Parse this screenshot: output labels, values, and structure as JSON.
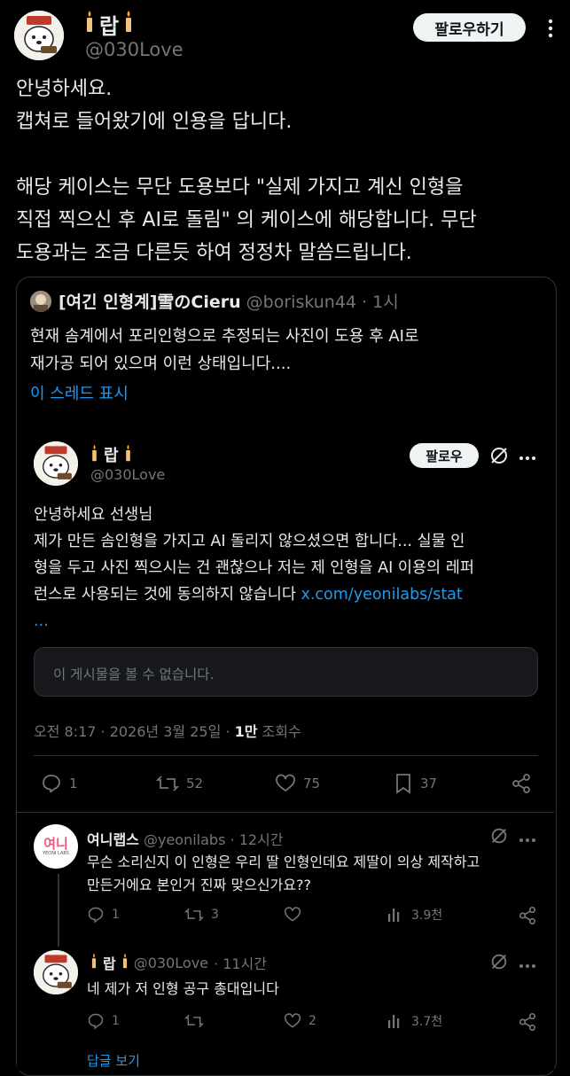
{
  "author": {
    "display_name": "랍",
    "handle": "@030Love",
    "follow_label": "팔로우하기"
  },
  "main_post": {
    "lines": [
      "안녕하세요.",
      "캡쳐로 들어왔기에 인용을 답니다.",
      "",
      "해당 케이스는 무단 도용보다 \"실제 가지고 계신 인형을",
      "직접 찍으신 후 AI로 돌림\" 의 케이스에 해당합니다. 무단",
      "도용과는 조금 다른듯 하여 정정차 말씀드립니다."
    ]
  },
  "quoted": {
    "display_name": "[여긴 인형계]雪のCieru",
    "handle": "@boriskun44",
    "time": "· 1시",
    "lines": [
      "현재 솜계에서 포리인형으로 추정되는 사진이 도용 후  AI로",
      "재가공 되어 있으며 이런 상태입니다...."
    ],
    "show_thread": "이 스레드 표시"
  },
  "inner_post": {
    "display_name": "랍",
    "handle": "@030Love",
    "follow_label": "팔로우",
    "lines": [
      "안녕하세요 선생님",
      "제가 만든 솜인형을 가지고 AI 돌리지 않으셨으면 합니다... 실물 인",
      "형을 두고 사진 찍으시는 건 괜찮으나 저는 제 인형을 AI 이용의 레퍼",
      "런스로 사용되는 것에 동의하지 않습니다 "
    ],
    "link": "x.com/yeonilabs/stat",
    "link_more": "...",
    "unavailable": "이 게시물을 볼 수 없습니다.",
    "meta_time": "오전 8:17 · 2026년 3월 25일 · ",
    "meta_views_num": "1만",
    "meta_views_label": " 조회수",
    "stats": {
      "replies": "1",
      "reposts": "52",
      "likes": "75",
      "bookmarks": "37"
    }
  },
  "reply1": {
    "display_name": "여니랩스",
    "handle": "@yeonilabs",
    "time": "· 12시간",
    "avatar_text": "여니",
    "avatar_sub": "YEONI LABS",
    "lines": [
      "무슨 소리신지 이 인형은 우리 딸 인형인데요 제딸이 의상 제작하고",
      "만든거에요 본인거 진짜 맞으신가요??"
    ],
    "stats": {
      "replies": "1",
      "reposts": "3",
      "likes": "",
      "views": "3.9천"
    }
  },
  "reply2": {
    "display_name": "랍",
    "handle": "@030Love",
    "time": "· 11시간",
    "lines": [
      "네 제가 저 인형 공구 총대입니다"
    ],
    "stats": {
      "replies": "1",
      "reposts": "",
      "likes": "2",
      "views": "3.7천"
    }
  },
  "more_replies": "답글 보기"
}
